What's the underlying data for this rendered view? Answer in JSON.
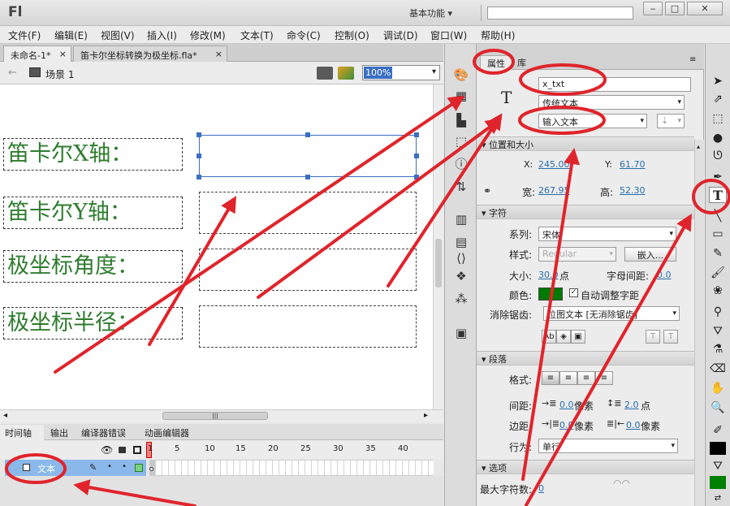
{
  "app": {
    "logo": "Fl",
    "workspace": "基本功能",
    "workspace_arrow": "▾",
    "win_min": "‒",
    "win_max": "□",
    "win_close": "✕"
  },
  "menu": [
    "文件(F)",
    "编辑(E)",
    "视图(V)",
    "插入(I)",
    "修改(M)",
    "文本(T)",
    "命令(C)",
    "控制(O)",
    "调试(D)",
    "窗口(W)",
    "帮助(H)"
  ],
  "doc_tabs": [
    {
      "label": "未命名-1*",
      "close": "×"
    },
    {
      "label": "笛卡尔坐标转换为极坐标.fla*",
      "close": "×"
    }
  ],
  "scene": {
    "back": "←",
    "name": "场景 1",
    "zoom": "100%",
    "zoom_arrow": "▾"
  },
  "stage": {
    "labels": [
      "笛卡尔X轴：",
      "笛卡尔Y轴：",
      "极坐标角度：",
      "极坐标半径："
    ]
  },
  "scrollbars": {
    "left": "◂",
    "right": "▸",
    "grip": "|||"
  },
  "timeline": {
    "tabs": [
      "时间轴",
      "输出",
      "编译器错误",
      "动画编辑器"
    ],
    "layer_name": "文本",
    "frame_numbers": [
      "1",
      "5",
      "10",
      "15",
      "20",
      "25",
      "30",
      "35",
      "40"
    ]
  },
  "properties": {
    "tabs": [
      "属性",
      "库"
    ],
    "panel_menu": "≡",
    "type_icon": "T",
    "instance_name": "x_txt",
    "text_engine": "传统文本",
    "text_type": "输入文本",
    "sections": {
      "position": "位置和大小",
      "character": "字符",
      "paragraph": "段落",
      "options": "选项"
    },
    "x_label": "X:",
    "x_value": "245.00",
    "y_label": "Y:",
    "y_value": "61.70",
    "width_label": "宽:",
    "width_value": "267.95",
    "height_label": "高:",
    "height_value": "52.30",
    "family_label": "系列:",
    "family_value": "宋体",
    "style_label": "样式:",
    "style_value": "Regular",
    "embed_button": "嵌入...",
    "size_label": "大小:",
    "size_value": "30.0",
    "size_unit": "点",
    "letter_spacing_label": "字母间距:",
    "letter_spacing_value": "0.0",
    "color_label": "颜色:",
    "text_color": "#007a00",
    "auto_kern_label": "自动调整字距",
    "aa_label": "消除锯齿:",
    "aa_value": "位图文本 [无消除锯齿]",
    "format_label": "格式:",
    "spacing_label": "间距:",
    "indent_value": "0.0",
    "indent_unit": "像素",
    "line_spacing_value": "2.0",
    "line_spacing_unit": "点",
    "margin_label": "边距:",
    "margin_left_value": "0.0",
    "margin_left_unit": "像素",
    "margin_right_value": "0.0",
    "margin_right_unit": "像素",
    "behavior_label": "行为:",
    "behavior_value": "单行",
    "max_chars_label": "最大字符数:",
    "max_chars_value": "0"
  },
  "colors": {
    "accent": "#3b6fc4",
    "stage_text": "#2f7d2f",
    "annotation": "#e0242b",
    "fill_green": "#008000"
  }
}
